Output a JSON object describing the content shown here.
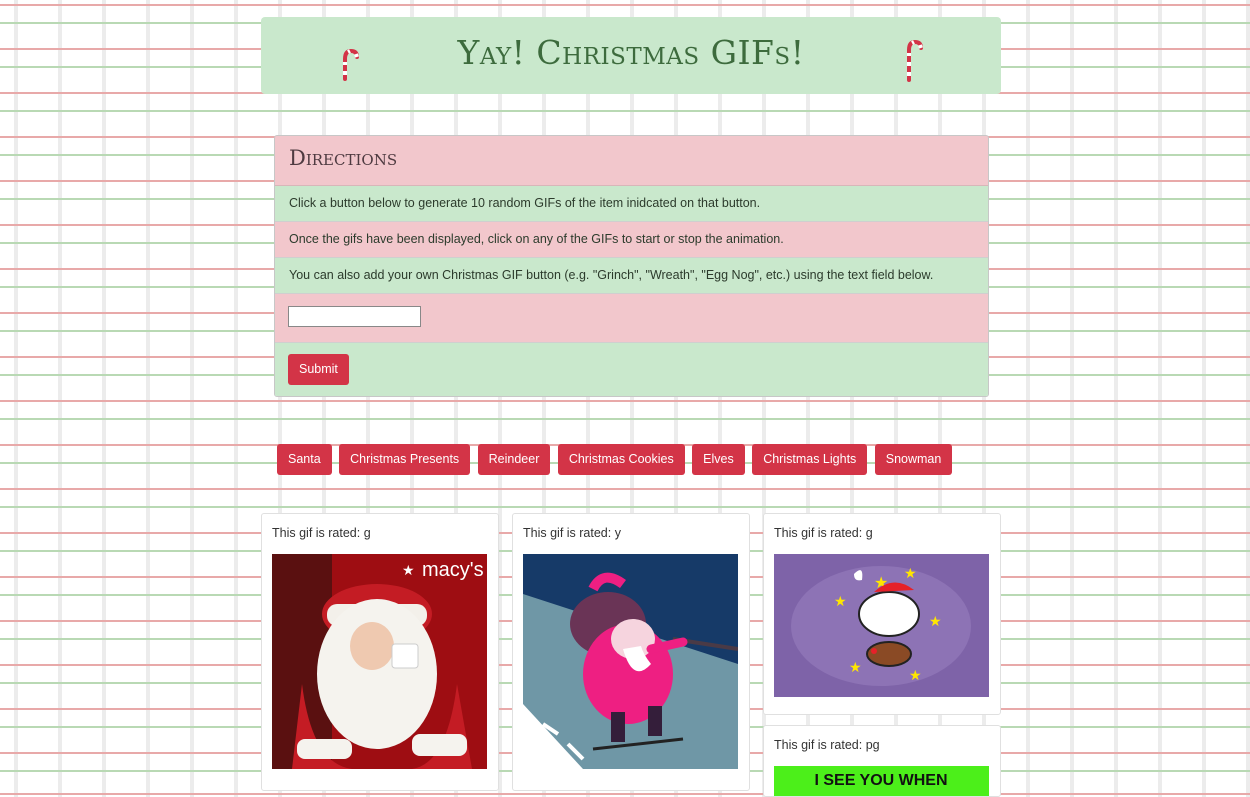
{
  "header": {
    "title": "Yay! Christmas GIFs!"
  },
  "directions": {
    "heading": "Directions",
    "line1": "Click a button below to generate 10 random GIFs of the item inidcated on that button.",
    "line2": "Once the gifs have been displayed, click on any of the GIFs to start or stop the animation.",
    "line3": "You can also add your own Christmas GIF button (e.g. \"Grinch\", \"Wreath\", \"Egg Nog\", etc.) using the text field below.",
    "input_value": "",
    "submit_label": "Submit"
  },
  "topics": [
    "Santa",
    "Christmas Presents",
    "Reindeer",
    "Christmas Cookies",
    "Elves",
    "Christmas Lights",
    "Snowman"
  ],
  "gifs": [
    {
      "rating": "This gif is rated: g",
      "logo_text": "macy's"
    },
    {
      "rating": "This gif is rated: y"
    },
    {
      "rating": "This gif is rated: g"
    },
    {
      "rating": "This gif is rated: pg",
      "caption": "I SEE YOU WHEN"
    }
  ],
  "colors": {
    "accent_red": "#d33447",
    "panel_green": "#c9e8cc",
    "panel_pink": "#f2c7cc"
  }
}
